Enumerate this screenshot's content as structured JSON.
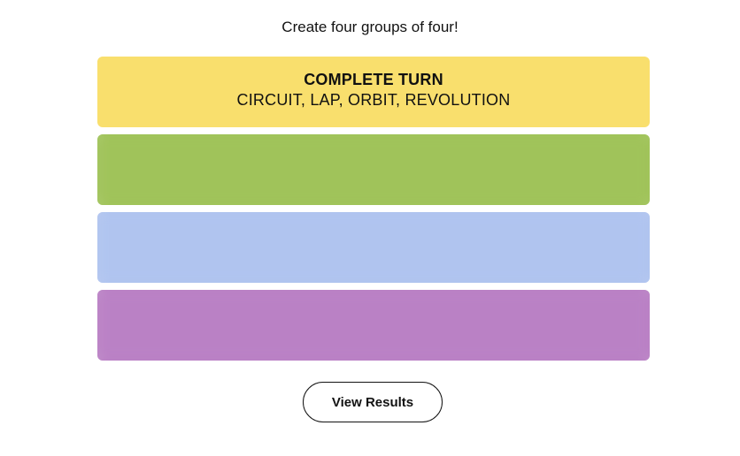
{
  "instructions": "Create four groups of four!",
  "groups": [
    {
      "title": "COMPLETE TURN",
      "members": "CIRCUIT, LAP, ORBIT, REVOLUTION",
      "color": "#f9df6d",
      "revealed": true
    },
    {
      "title": "",
      "members": "",
      "color": "#a0c35a",
      "revealed": false
    },
    {
      "title": "",
      "members": "",
      "color": "#b0c4ef",
      "revealed": false
    },
    {
      "title": "",
      "members": "",
      "color": "#ba81c5",
      "revealed": false
    }
  ],
  "results_button_label": "View Results"
}
